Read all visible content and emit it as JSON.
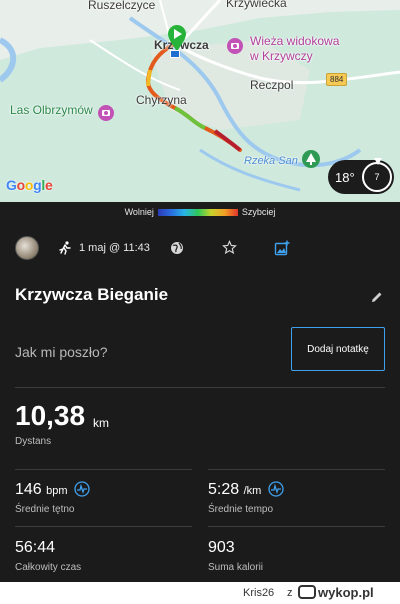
{
  "map": {
    "labels": {
      "ruszelczyce": "Ruszelczyce",
      "krzywiecka": "Krzywiecka",
      "krzywcza": "Krzywcza",
      "wieza": "Wieża widokowa",
      "wieza2": "w Krzywczy",
      "chyrzyna": "Chyrzyna",
      "reczpol": "Reczpol",
      "las": "Las Olbrzymów",
      "rzeka": "Rzeka San",
      "road": "884"
    },
    "google": [
      "G",
      "o",
      "o",
      "g",
      "l",
      "e"
    ],
    "weather": {
      "temp": "18°",
      "wind": "7"
    }
  },
  "legend": {
    "slower": "Wolniej",
    "faster": "Szybciej"
  },
  "activity": {
    "date": "1 maj @ 11:43",
    "title": "Krzywcza Bieganie",
    "prompt": "Jak mi poszło?",
    "note_button": "Dodaj notatkę"
  },
  "stats": {
    "distance": {
      "value": "10,38",
      "unit": "km",
      "label": "Dystans"
    },
    "heart": {
      "value": "146",
      "unit": "bpm",
      "label": "Średnie tętno"
    },
    "pace": {
      "value": "5:28",
      "unit": "/km",
      "label": "Średnie tempo"
    },
    "time": {
      "value": "56:44",
      "label": "Całkowity czas"
    },
    "calories": {
      "value": "903",
      "label": "Suma kalorii"
    }
  },
  "footer": {
    "user": "Kris26",
    "z": "z",
    "site": "wykop.pl"
  },
  "colors": {
    "accent": "#3fa1ee",
    "background": "#1b1b1b",
    "map": "#cfe9dd"
  }
}
